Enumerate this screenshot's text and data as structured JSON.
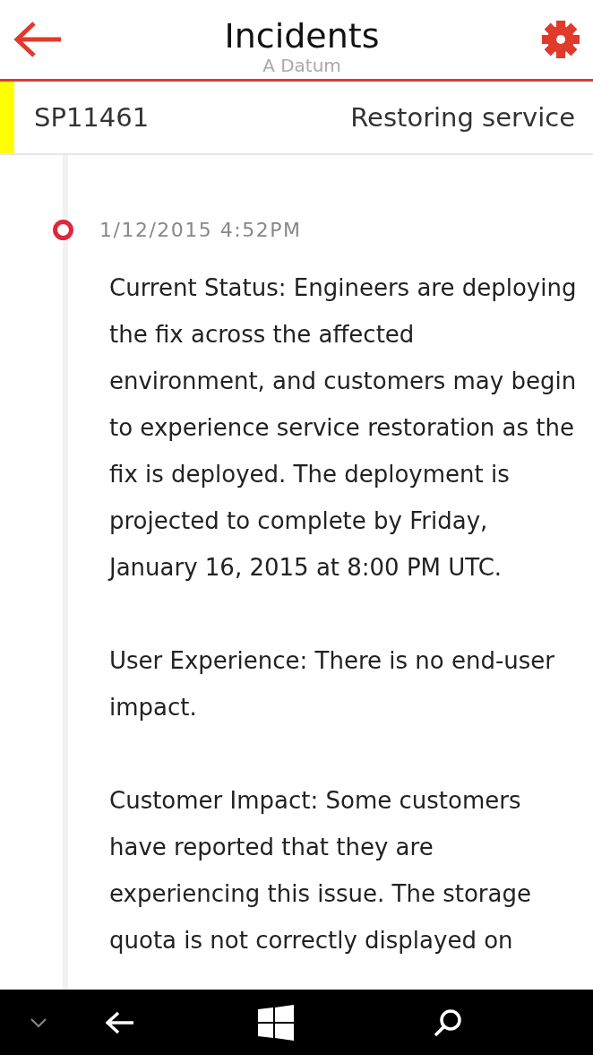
{
  "header": {
    "title": "Incidents",
    "subtitle": "A Datum"
  },
  "incident": {
    "id": "SP11461",
    "status": "Restoring service",
    "color": "#ffff00"
  },
  "updates": [
    {
      "time": "1/12/2015 4:52PM",
      "paragraphs": [
        "Current Status: Engineers are deploying the fix across the affected environment, and customers may begin to experience service restoration as the fix is deployed. The deployment is projected to complete by Friday, January 16, 2015 at 8:00 PM UTC.",
        "User Experience: There is no end-user impact.",
        "Customer Impact: Some customers have reported that they are experiencing this issue. The storage quota is not correctly displayed on"
      ]
    }
  ]
}
